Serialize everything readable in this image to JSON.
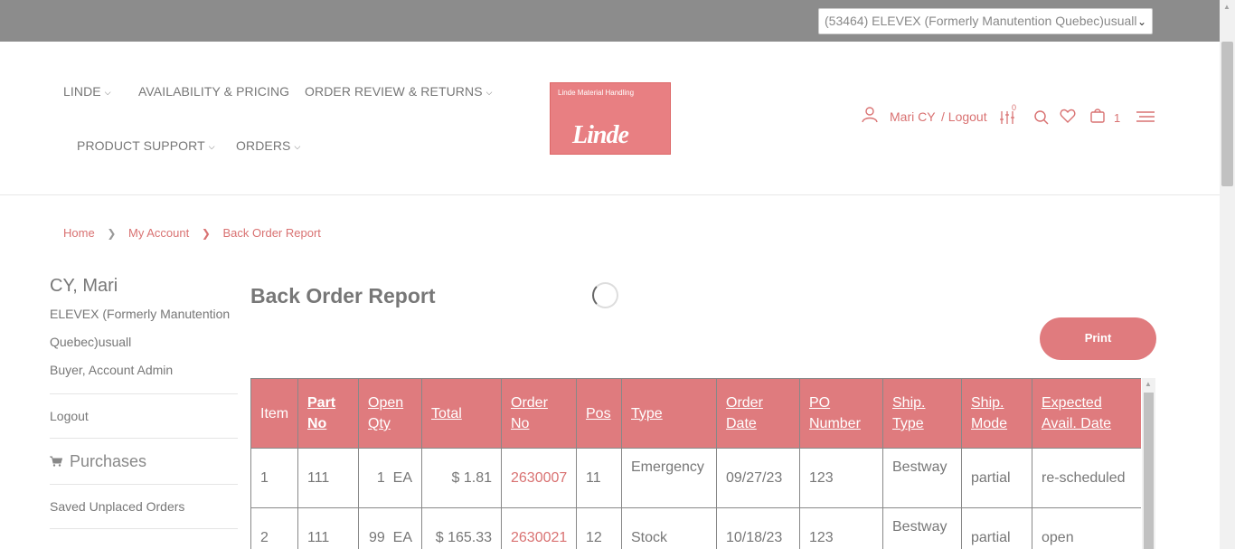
{
  "topbar": {
    "account_select": "(53464) ELEVEX (Formerly Manutention Quebec)usuall"
  },
  "nav": {
    "linde": "LINDE",
    "availability": "AVAILABILITY & PRICING",
    "order_review": "ORDER REVIEW & RETURNS",
    "product_support": "PRODUCT SUPPORT",
    "orders": "ORDERS"
  },
  "logo": {
    "tagline": "Linde Material Handling",
    "brand": "Linde"
  },
  "header_right": {
    "user": "Mari CY",
    "logout": "/ Logout",
    "compare_count": "0",
    "cart_count": "1"
  },
  "breadcrumb": {
    "home": "Home",
    "account": "My Account",
    "current": "Back Order Report"
  },
  "sidebar": {
    "name": "CY, Mari",
    "company_line1": "ELEVEX (Formerly Manutention",
    "company_line2": "Quebec)usuall",
    "roles": "Buyer, Account Admin",
    "logout": "Logout",
    "purchases": "Purchases",
    "saved_orders": "Saved Unplaced Orders"
  },
  "main": {
    "title": "Back Order Report",
    "print": "Print"
  },
  "table": {
    "headers": {
      "item": "Item",
      "part_no_1": "Part",
      "part_no_2": "No",
      "open_qty_1": "Open",
      "open_qty_2": "Qty",
      "total": "Total",
      "order_no_1": "Order",
      "order_no_2": "No",
      "pos": "Pos",
      "type": "Type",
      "order_date_1": "Order",
      "order_date_2": "Date",
      "po_number_1": "PO",
      "po_number_2": "Number",
      "ship_type_1": "Ship.",
      "ship_type_2": "Type",
      "ship_mode_1": "Ship.",
      "ship_mode_2": "Mode",
      "expected_1": "Expected",
      "expected_2": "Avail. Date"
    },
    "rows": [
      {
        "item": "1",
        "part_no": "111",
        "open_qty": "1  EA",
        "total": "$ 1.81",
        "order_no": "2630007",
        "pos": "11",
        "type": "Emergency",
        "order_date": "09/27/23",
        "po_number": "123",
        "ship_type": "Bestway",
        "ship_mode": "partial",
        "expected": "re-scheduled"
      },
      {
        "item": "2",
        "part_no": "111",
        "open_qty": "99  EA",
        "total": "$ 165.33",
        "order_no": "2630021",
        "pos": "12",
        "type": "Stock",
        "order_date": "10/18/23",
        "po_number": "123",
        "ship_type": "Bestway",
        "ship_mode": "partial",
        "expected": "open"
      }
    ]
  },
  "colors": {
    "accent": "#df7b7e",
    "link": "#d97272",
    "topbar": "#8c8c8c"
  }
}
